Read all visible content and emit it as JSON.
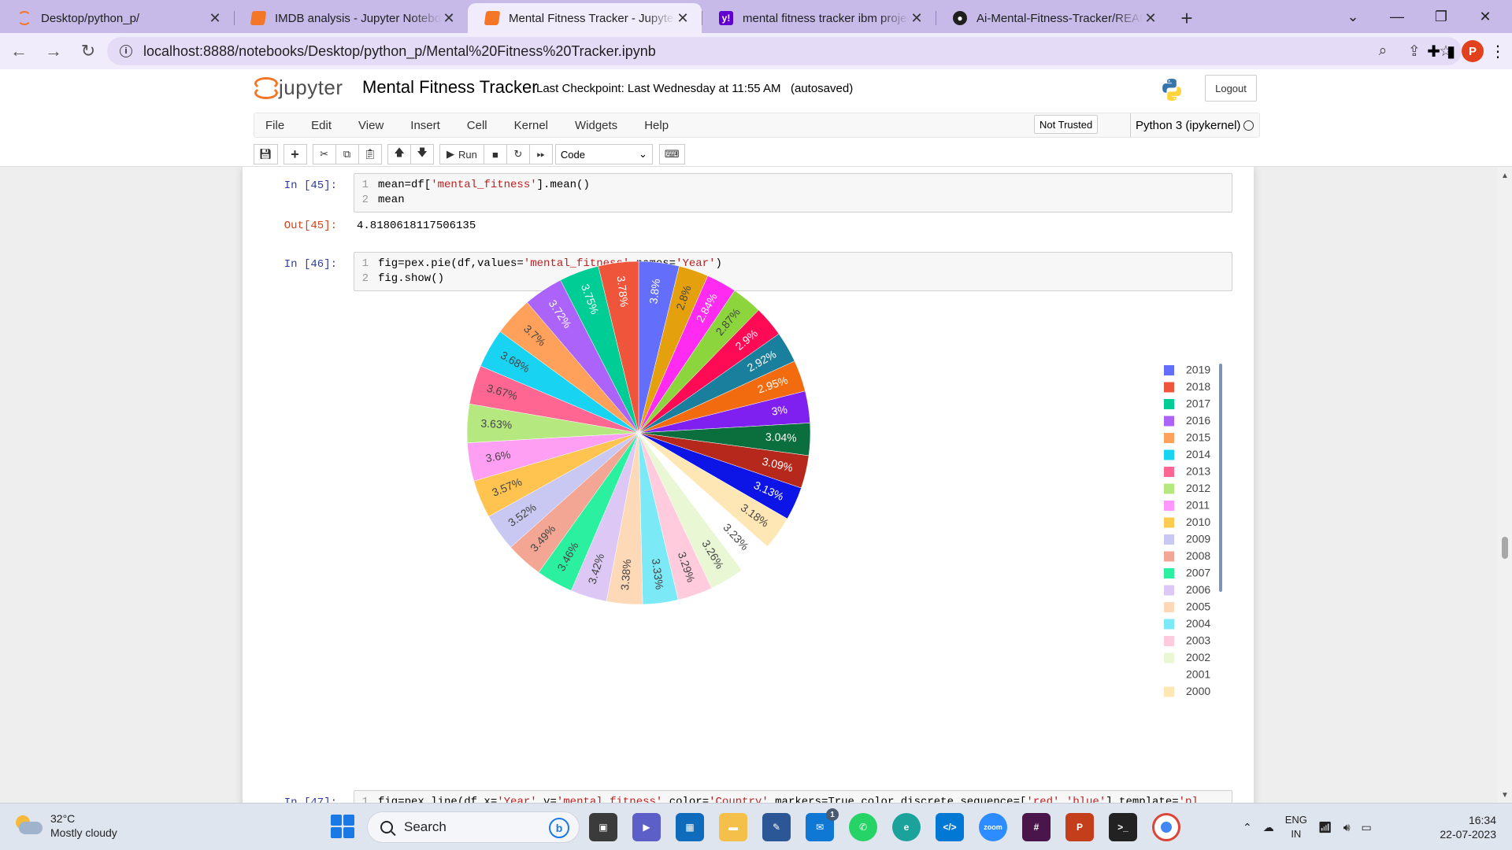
{
  "browser": {
    "tabs": [
      {
        "title": "Desktop/python_p/",
        "icon": "jupyter-icon",
        "active": false
      },
      {
        "title": "IMDB analysis - Jupyter Notebook",
        "icon": "notebook-icon",
        "active": false
      },
      {
        "title": "Mental Fitness Tracker - Jupyter Notebook",
        "icon": "notebook-icon",
        "active": true
      },
      {
        "title": "mental fitness tracker ibm project",
        "icon": "yahoo-icon",
        "active": false
      },
      {
        "title": "Ai-Mental-Fitness-Tracker/README",
        "icon": "github-icon",
        "active": false
      }
    ],
    "url": "localhost:8888/notebooks/Desktop/python_p/Mental%20Fitness%20Tracker.ipynb",
    "profile_initial": "P",
    "tab_bar_color": "#c7b9e8"
  },
  "jupyter": {
    "logo_text": "jupyter",
    "notebook_title": "Mental Fitness Tracker",
    "checkpoint": "Last Checkpoint: Last Wednesday at 11:55 AM",
    "autosave": "(autosaved)",
    "logout_label": "Logout",
    "menu": [
      "File",
      "Edit",
      "View",
      "Insert",
      "Cell",
      "Kernel",
      "Widgets",
      "Help"
    ],
    "trust_label": "Not Trusted",
    "kernel_label": "Python 3 (ipykernel)",
    "toolbar": {
      "run_label": "Run",
      "cell_type": "Code"
    }
  },
  "cells": {
    "c45": {
      "in_prompt": "In [45]:",
      "out_prompt": "Out[45]:",
      "output": "4.8180618117506135"
    },
    "c46": {
      "in_prompt": "In [46]:"
    },
    "c47": {
      "in_prompt": "In [47]:"
    }
  },
  "chart_data": {
    "type": "pie",
    "categories": [
      "2019",
      "2018",
      "2017",
      "2016",
      "2015",
      "2014",
      "2013",
      "2012",
      "2011",
      "2010",
      "2009",
      "2008",
      "2007",
      "2006",
      "2005",
      "2004",
      "2003",
      "2002",
      "2001",
      "2000"
    ],
    "legend_position": "right",
    "slices": [
      {
        "label": "2019",
        "value": 3.8,
        "color": "#636efa"
      },
      {
        "label": "2000",
        "value": 2.8,
        "color": "#e5a00d"
      },
      {
        "label": "2001",
        "value": 2.84,
        "color": "#ff2bf0"
      },
      {
        "label": "2002",
        "value": 2.87,
        "color": "#8cd53c"
      },
      {
        "label": "2003",
        "value": 2.9,
        "color": "#ff0a54"
      },
      {
        "label": "2004",
        "value": 2.92,
        "color": "#1a7f9c"
      },
      {
        "label": "2005",
        "value": 2.95,
        "color": "#f26b0f"
      },
      {
        "label": "2006",
        "value": 3,
        "color": "#7f1ff0"
      },
      {
        "label": "2007",
        "value": 3.04,
        "color": "#0b6e3d"
      },
      {
        "label": "2008",
        "value": 3.09,
        "color": "#b5281b"
      },
      {
        "label": "2009",
        "value": 3.13,
        "color": "#0c14e6"
      },
      {
        "label": "2010",
        "value": 3.18,
        "color": "#fee7b5"
      },
      {
        "label": "2011",
        "value": 3.23,
        "color": "#ffffff"
      },
      {
        "label": "2012",
        "value": 3.26,
        "color": "#e9f7d5"
      },
      {
        "label": "2013",
        "value": 3.29,
        "color": "#ffcbdd"
      },
      {
        "label": "2014",
        "value": 3.33,
        "color": "#7ce9f7"
      },
      {
        "label": "2015",
        "value": 3.38,
        "color": "#fed9b7"
      },
      {
        "label": "2016",
        "value": 3.42,
        "color": "#dcc7f5"
      },
      {
        "label": "2017",
        "value": 3.46,
        "color": "#2af0a0"
      },
      {
        "label": "2018",
        "value": 3.49,
        "color": "#f4a695"
      },
      {
        "label": "2019",
        "value": 3.52,
        "color": "#c8c8f2"
      },
      {
        "label": "2018",
        "value": 3.57,
        "color": "#fec44f"
      },
      {
        "label": "2017",
        "value": 3.6,
        "color": "#ff9ff3"
      },
      {
        "label": "2016",
        "value": 3.63,
        "color": "#b6e880"
      },
      {
        "label": "2015",
        "value": 3.67,
        "color": "#ff6692"
      },
      {
        "label": "2014",
        "value": 3.68,
        "color": "#19d3f3"
      },
      {
        "label": "2013",
        "value": 3.7,
        "color": "#ffa15a"
      },
      {
        "label": "2012",
        "value": 3.72,
        "color": "#ab63fa"
      },
      {
        "label": "2011",
        "value": 3.75,
        "color": "#00cc96"
      },
      {
        "label": "2010",
        "value": 3.78,
        "color": "#ef553b"
      }
    ],
    "legend": [
      {
        "label": "2019",
        "color": "#636efa"
      },
      {
        "label": "2018",
        "color": "#ef553b"
      },
      {
        "label": "2017",
        "color": "#00cc96"
      },
      {
        "label": "2016",
        "color": "#ab63fa"
      },
      {
        "label": "2015",
        "color": "#ffa15a"
      },
      {
        "label": "2014",
        "color": "#19d3f3"
      },
      {
        "label": "2013",
        "color": "#ff6692"
      },
      {
        "label": "2012",
        "color": "#b6e880"
      },
      {
        "label": "2011",
        "color": "#ff97ff"
      },
      {
        "label": "2010",
        "color": "#fecb52"
      },
      {
        "label": "2009",
        "color": "#c8c8f2"
      },
      {
        "label": "2008",
        "color": "#f4a695"
      },
      {
        "label": "2007",
        "color": "#2af0a0"
      },
      {
        "label": "2006",
        "color": "#dcc7f5"
      },
      {
        "label": "2005",
        "color": "#fed9b7"
      },
      {
        "label": "2004",
        "color": "#7ce9f7"
      },
      {
        "label": "2003",
        "color": "#ffcbdd"
      },
      {
        "label": "2002",
        "color": "#e9f7d5"
      },
      {
        "label": "2001",
        "color": "#ffffff"
      },
      {
        "label": "2000",
        "color": "#fee7b5"
      }
    ]
  },
  "taskbar": {
    "temperature": "32°C",
    "weather": "Mostly cloudy",
    "search_label": "Search",
    "language": "ENG",
    "region": "IN",
    "time": "16:34",
    "date": "22-07-2023",
    "mail_badge": "1"
  }
}
